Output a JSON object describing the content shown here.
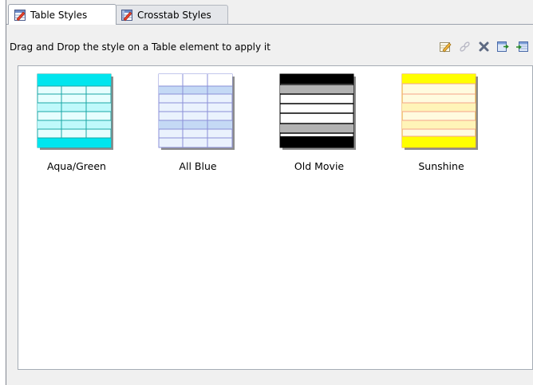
{
  "tabs": [
    {
      "label": "Table Styles",
      "active": true,
      "icon": "table-style-icon"
    },
    {
      "label": "Crosstab Styles",
      "active": false,
      "icon": "crosstab-style-icon"
    }
  ],
  "header": {
    "instruction": "Drag and Drop the style on a Table element to apply it"
  },
  "toolbar": {
    "buttons": [
      {
        "name": "edit-style-icon"
      },
      {
        "name": "unlink-style-icon"
      },
      {
        "name": "delete-icon"
      },
      {
        "name": "export-icon"
      },
      {
        "name": "import-icon"
      }
    ]
  },
  "styles": [
    {
      "label": "Aqua/Green",
      "colors": {
        "header": "#00e5ee",
        "band": "#bff9fb",
        "row": "#e6fefe",
        "line": "#1aa6a6",
        "footer": "#00e5ee"
      }
    },
    {
      "label": "All Blue",
      "colors": {
        "header": "#c4d9f5",
        "band": "#c4d9f5",
        "row": "#eaf2fd",
        "line": "#8a8fd8",
        "footer": "#eaf2fd"
      }
    },
    {
      "label": "Old Movie",
      "colors": {
        "header": "#000000",
        "band": "#b3b3b3",
        "row": "#ffffff",
        "line": "#000000",
        "footer": "#000000"
      }
    },
    {
      "label": "Sunshine",
      "colors": {
        "header": "#ffff00",
        "band": "#fff4b8",
        "row": "#fffbdf",
        "line": "#f4a38a",
        "footer": "#ffff00"
      }
    }
  ]
}
